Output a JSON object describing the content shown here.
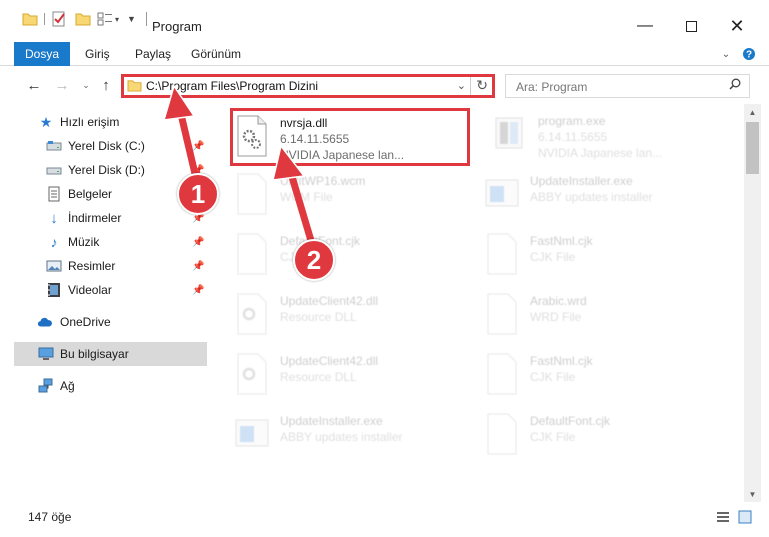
{
  "window": {
    "title": "Program",
    "minimize_icon": "minimize-icon",
    "maximize_icon": "maximize-icon",
    "close_icon": "close-icon"
  },
  "ribbon": {
    "tabs": [
      "Dosya",
      "Giriş",
      "Paylaş",
      "Görünüm"
    ]
  },
  "address": {
    "path": "C:\\Program Files\\Program Dizini",
    "search_placeholder": "Ara: Program"
  },
  "sidebar": {
    "items": [
      {
        "label": "Hızlı erişim",
        "icon": "star-icon"
      },
      {
        "label": "Yerel Disk (C:)",
        "icon": "drive-icon"
      },
      {
        "label": "Yerel Disk (D:)",
        "icon": "drive-icon"
      },
      {
        "label": "Belgeler",
        "icon": "documents-icon"
      },
      {
        "label": "İndirmeler",
        "icon": "download-icon"
      },
      {
        "label": "Müzik",
        "icon": "music-icon"
      },
      {
        "label": "Resimler",
        "icon": "pictures-icon"
      },
      {
        "label": "Videolar",
        "icon": "video-icon"
      },
      {
        "label": "OneDrive",
        "icon": "cloud-icon"
      },
      {
        "label": "Bu bilgisayar",
        "icon": "computer-icon"
      },
      {
        "label": "Ağ",
        "icon": "network-icon"
      }
    ]
  },
  "files": [
    {
      "name": "nvrsja.dll",
      "line2": "6.14.11.5655",
      "line3": "NVIDIA Japanese lan..."
    },
    {
      "name": "program.exe",
      "line2": "6.14.11.5655",
      "line3": "NVIDIA Japanese lan..."
    },
    {
      "name": "UntitWP16.wcm",
      "line2": "WCM File",
      "line3": ""
    },
    {
      "name": "UpdateInstaller.exe",
      "line2": "ABBY updates installer",
      "line3": ""
    },
    {
      "name": "DefaultFont.cjk",
      "line2": "CJK File",
      "line3": ""
    },
    {
      "name": "FastNml.cjk",
      "line2": "CJK File",
      "line3": ""
    },
    {
      "name": "UpdateClient42.dll",
      "line2": "Resource DLL",
      "line3": ""
    },
    {
      "name": "Arabic.wrd",
      "line2": "WRD File",
      "line3": ""
    },
    {
      "name": "UpdateClient42.dll",
      "line2": "Resource DLL",
      "line3": ""
    },
    {
      "name": "FastNml.cjk",
      "line2": "CJK File",
      "line3": ""
    },
    {
      "name": "UpdateInstaller.exe",
      "line2": "ABBY updates installer",
      "line3": ""
    },
    {
      "name": "DefaultFont.cjk",
      "line2": "CJK File",
      "line3": ""
    }
  ],
  "status": {
    "count": "147 öğe"
  },
  "annotations": {
    "badge1": "1",
    "badge2": "2",
    "color": "#e0383f"
  }
}
